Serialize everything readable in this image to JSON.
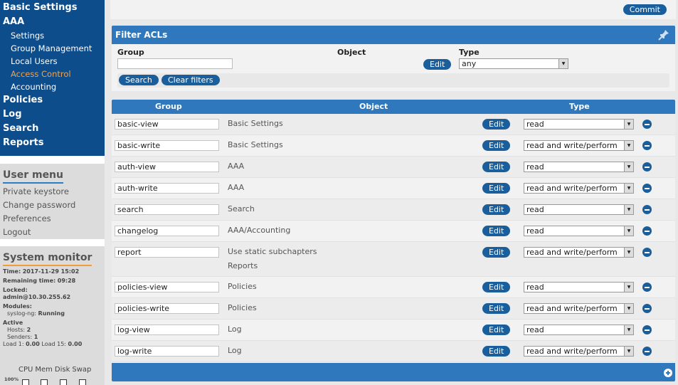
{
  "nav": {
    "basic_settings": "Basic Settings",
    "aaa": "AAA",
    "settings": "Settings",
    "group_management": "Group Management",
    "local_users": "Local Users",
    "access_control": "Access Control",
    "accounting": "Accounting",
    "policies": "Policies",
    "log": "Log",
    "search": "Search",
    "reports": "Reports"
  },
  "user_menu": {
    "title": "User menu",
    "items": [
      "Private keystore",
      "Change password",
      "Preferences",
      "Logout"
    ]
  },
  "system_monitor": {
    "title": "System monitor",
    "time_label": "Time:",
    "time_value": "2017-11-29 15:02",
    "remaining_label": "Remaining time:",
    "remaining_value": "09:28",
    "locked_label": "Locked:",
    "locked_value": "admin@10.30.255.62",
    "modules_label": "Modules:",
    "module_name": "syslog-ng:",
    "module_status": "Running",
    "active_label": "Active",
    "hosts_label": "Hosts:",
    "hosts_value": "2",
    "senders_label": "Senders:",
    "senders_value": "1",
    "load1_label": "Load 1:",
    "load1_value": "0.00",
    "load15_label": "Load 15:",
    "load15_value": "0.00",
    "cols": [
      "CPU",
      "Mem",
      "Disk",
      "Swap"
    ],
    "pct_label": "100%"
  },
  "toolbar": {
    "commit_label": "Commit"
  },
  "filter": {
    "title": "Filter ACLs",
    "group_label": "Group",
    "group_value": "",
    "object_label": "Object",
    "edit_label": "Edit",
    "type_label": "Type",
    "type_value": "any",
    "search_label": "Search",
    "clear_label": "Clear filters"
  },
  "table": {
    "headers": {
      "group": "Group",
      "object": "Object",
      "type": "Type"
    },
    "edit_label": "Edit",
    "rows": [
      {
        "group": "basic-view",
        "object": "Basic Settings",
        "object2": "",
        "type": "read"
      },
      {
        "group": "basic-write",
        "object": "Basic Settings",
        "object2": "",
        "type": "read and write/perform"
      },
      {
        "group": "auth-view",
        "object": "AAA",
        "object2": "",
        "type": "read"
      },
      {
        "group": "auth-write",
        "object": "AAA",
        "object2": "",
        "type": "read and write/perform"
      },
      {
        "group": "search",
        "object": "Search",
        "object2": "",
        "type": "read"
      },
      {
        "group": "changelog",
        "object": "AAA/Accounting",
        "object2": "",
        "type": "read"
      },
      {
        "group": "report",
        "object": "Use static subchapters",
        "object2": "Reports",
        "type": "read and write/perform"
      },
      {
        "group": "policies-view",
        "object": "Policies",
        "object2": "",
        "type": "read"
      },
      {
        "group": "policies-write",
        "object": "Policies",
        "object2": "",
        "type": "read and write/perform"
      },
      {
        "group": "log-view",
        "object": "Log",
        "object2": "",
        "type": "read"
      },
      {
        "group": "log-write",
        "object": "Log",
        "object2": "",
        "type": "read and write/perform"
      }
    ]
  },
  "colors": {
    "nav_bg": "#0e4d8b",
    "header_blue": "#2f78be",
    "button_blue": "#1b5e9c",
    "active_orange": "#f3a24a"
  }
}
